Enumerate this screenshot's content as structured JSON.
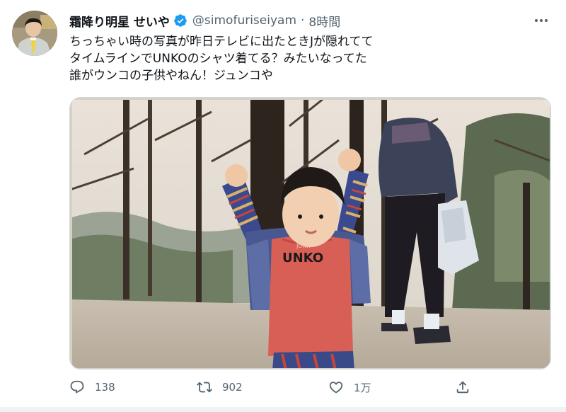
{
  "tweet": {
    "display_name": "霜降り明星 せいや",
    "handle": "@simofuriseiyam",
    "separator": "·",
    "time": "8時間",
    "verified": true,
    "text_lines": [
      "ちっちゃい時の写真が昨日テレビに出たときJが隠れてて",
      "タイムラインでUNKOのシャツ着てる？みたいなってた",
      "誰がウンコの子供やねん！ジュンコや"
    ],
    "photo_shirt_text": "UNKO",
    "photo_shirt_text_top": "JUNK"
  },
  "actions": {
    "reply_count": "138",
    "retweet_count": "902",
    "like_count": "1万"
  },
  "colors": {
    "verified_blue": "#1d9bf0",
    "secondary_text": "#536471",
    "primary_text": "#0f1419"
  },
  "icons": {
    "more": "more-horizontal-icon",
    "reply": "reply-icon",
    "retweet": "retweet-icon",
    "like": "heart-icon",
    "share": "share-icon",
    "verified": "verified-badge-icon"
  }
}
